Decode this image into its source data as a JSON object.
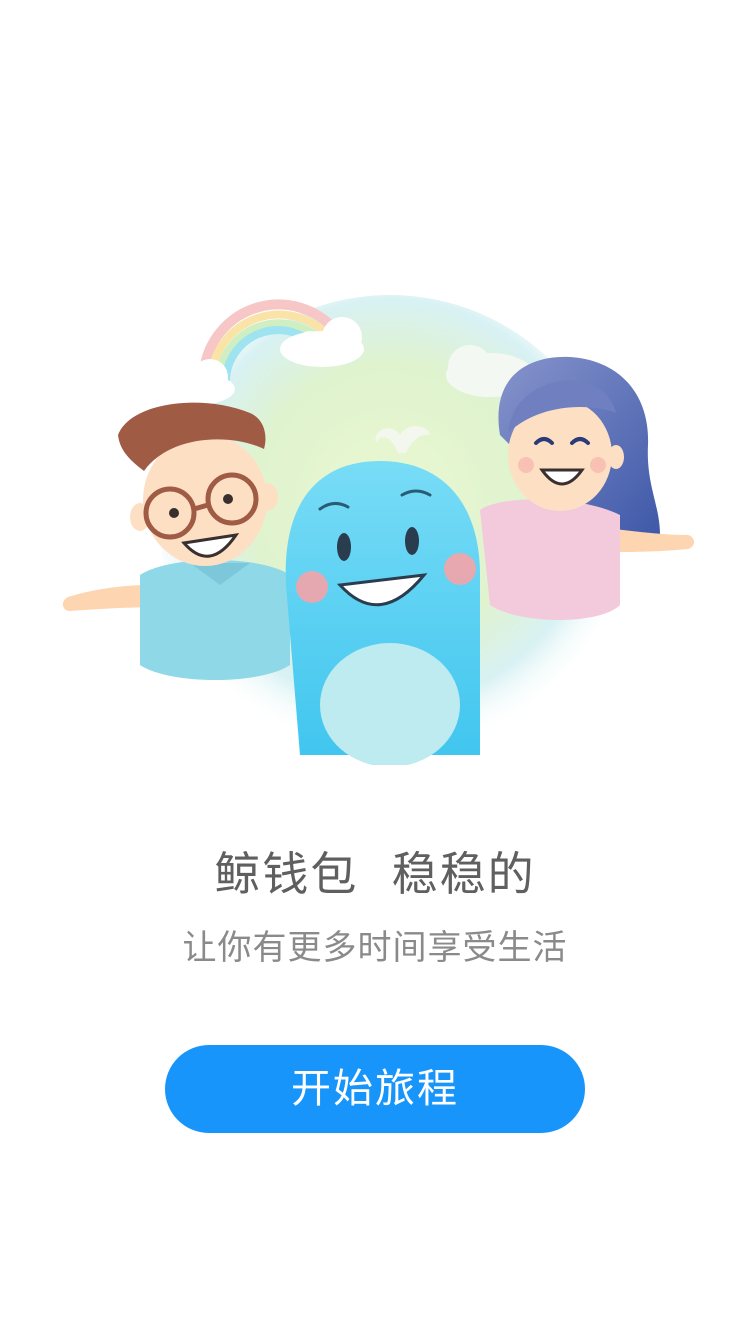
{
  "splash": {
    "headline": "鲸钱包  稳稳的",
    "subtitle": "让你有更多时间享受生活",
    "start_button_label": "开始旅程"
  },
  "colors": {
    "accent": "#1795fb",
    "headline_text": "#5f5f5f",
    "subtitle_text": "#8a8a8a",
    "background": "#ffffff"
  },
  "illustration": {
    "elements": [
      "rainbow",
      "cloud-icon",
      "boy-with-glasses",
      "whale-mascot",
      "girl-character"
    ]
  }
}
